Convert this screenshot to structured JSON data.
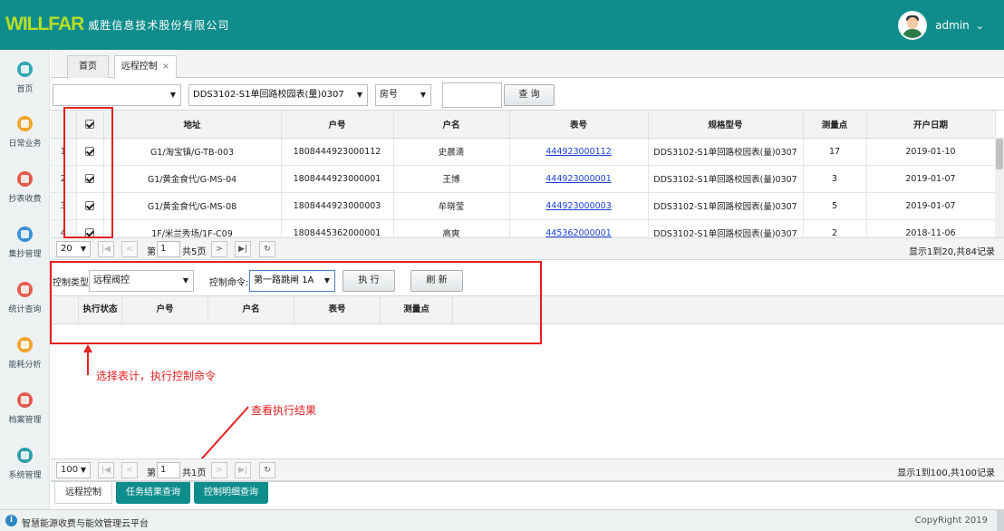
{
  "header": {
    "logo_mark": "WILLFAR",
    "company": "威胜信息技术股份有限公司",
    "user": "admin"
  },
  "sidebar": {
    "items": [
      {
        "label": "首页",
        "icon": "home-icon",
        "color": "#31a7b5"
      },
      {
        "label": "日常业务",
        "icon": "briefcase-icon",
        "color": "#f0a42b"
      },
      {
        "label": "抄表收费",
        "icon": "meter-reading-icon",
        "color": "#e25b4c"
      },
      {
        "label": "集抄管理",
        "icon": "bar-chart-icon",
        "color": "#3b8fd6"
      },
      {
        "label": "统计查询",
        "icon": "statistics-icon",
        "color": "#e55d4d"
      },
      {
        "label": "能耗分析",
        "icon": "energy-icon",
        "color": "#f0a42b"
      },
      {
        "label": "档案管理",
        "icon": "archive-icon",
        "color": "#e25b4c"
      },
      {
        "label": "系统管理",
        "icon": "system-icon",
        "color": "#2f9ea8"
      }
    ]
  },
  "tabs": [
    {
      "label": "首页"
    },
    {
      "label": "远程控制",
      "close": "×"
    }
  ],
  "filter": {
    "select1": "",
    "meter_model": "DDS3102-S1单回路校园表(量)0307",
    "field": "房号",
    "query_value": "",
    "query_button": "查 询"
  },
  "table": {
    "headers": [
      "",
      "",
      "地址",
      "户号",
      "户名",
      "表号",
      "规格型号",
      "测量点",
      "开户日期"
    ],
    "rows": [
      {
        "n": "1",
        "checked": true,
        "address": "G1/淘宝镇/G-TB-003",
        "account": "1808444923000112",
        "name": "史晨滴",
        "meter": "444923000112",
        "model": "DDS3102-S1单回路校园表(量)0307",
        "point": "17",
        "date": "2019-01-10"
      },
      {
        "n": "2",
        "checked": true,
        "address": "G1/黄金食代/G-MS-04",
        "account": "1808444923000001",
        "name": "王博",
        "meter": "444923000001",
        "model": "DDS3102-S1单回路校园表(量)0307",
        "point": "3",
        "date": "2019-01-07"
      },
      {
        "n": "3",
        "checked": true,
        "address": "G1/黄金食代/G-MS-08",
        "account": "1808444923000003",
        "name": "牟晓莹",
        "meter": "444923000003",
        "model": "DDS3102-S1单回路校园表(量)0307",
        "point": "5",
        "date": "2019-01-07"
      },
      {
        "n": "4",
        "checked": true,
        "address": "1F/米兰秀场/1F-C09",
        "account": "1808445362000001",
        "name": "高爽",
        "meter": "445362000001",
        "model": "DDS3102-S1单回路校园表(量)0307",
        "point": "2",
        "date": "2018-11-06"
      }
    ]
  },
  "pager1": {
    "page_size": "20",
    "page_prefix": "第",
    "page": "1",
    "page_total": "共5页",
    "record": "显示1到20,共84记录"
  },
  "control": {
    "type_label": "控制类型",
    "type_value": "远程阀控",
    "cmd_label": "控制命令:",
    "cmd_value": "第一路跳闸 1A",
    "execute": "执 行",
    "refresh": "刷 新"
  },
  "result_table": {
    "headers": [
      "",
      "执行状态",
      "户号",
      "户名",
      "表号",
      "测量点"
    ]
  },
  "annotations": {
    "note1": "选择表计，执行控制命令",
    "note2": "查看执行结果"
  },
  "pager2": {
    "page_size": "100",
    "page_prefix": "第",
    "page": "1",
    "page_total": "共1页",
    "record": "显示1到100,共100记录"
  },
  "bottom_tabs": [
    {
      "label": "远程控制"
    },
    {
      "label": "任务结果查询"
    },
    {
      "label": "控制明细查询"
    }
  ],
  "footer": {
    "info": "i",
    "platform": "智慧能源收费与能效管理云平台",
    "copyright": "CopyRight 2019"
  },
  "colors": {
    "brand": "#0f8d8d",
    "annotation": "#e52121",
    "link": "#1a3fd6"
  }
}
